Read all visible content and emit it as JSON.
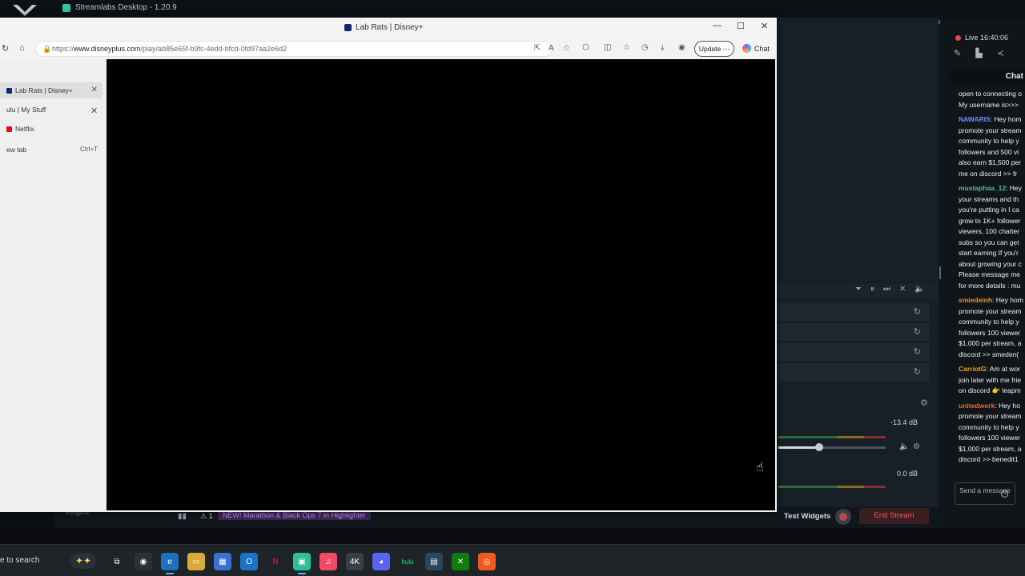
{
  "streamlabs": {
    "window_title": "Streamlabs Desktop - 1.20.9",
    "live_status": "Live 16:40:06",
    "chat_title": "Chat",
    "chat_messages": [
      {
        "user": "",
        "color": "#eef1f3",
        "text": "open to connecting o\nMy username is>>>"
      },
      {
        "user": "NAWARIS",
        "color": "#6f8bff",
        "text": ": Hey hom\npromote your stream\ncommunity to help y\nfollowers and 500 vi\nalso earn $1,500 per\nme on discord >> fr"
      },
      {
        "user": "mustaphaa_12",
        "color": "#4fc08d",
        "text": ": Hey\nyour streams and th\nyou're putting in I ca\ngrow to 1K+ follower\nviewers, 100 chatter\nsubs so you can get\nstart earning If you'r\nabout growing your c\nPlease message me\nfor more details : mu"
      },
      {
        "user": "smiedeinh",
        "color": "#e8913a",
        "text": ": Hey hom\npromote your stream\ncommunity to help y\nfollowers 100 viewer\n$1,000 per stream, a\ndiscord >> smeden("
      },
      {
        "user": "CarriotG",
        "color": "#f0a020",
        "text": ": Am at wor\njoin later with me frie\non discord 👉 leapm"
      },
      {
        "user": "unitedwork",
        "color": "#f06a20",
        "text": ": Hey ho\npromote your stream\ncommunity to help y\nfollowers 100 viewer\n$1,000 per stream, a\ndiscord >> benedit1"
      }
    ],
    "send_placeholder": "Send a message",
    "mixer": {
      "db_top": "-13.4 dB",
      "db_bottom": "0.0 dB",
      "volume_level": 0.38
    },
    "footer": {
      "news": "NEW! Marathon & Black Ops 7 in Highlighter",
      "alert_count": "1",
      "test_widgets": "Test Widgets",
      "end_stream": "End Stream",
      "user": "Kingtoz"
    }
  },
  "edge": {
    "window_title": "Lab Rats | Disney+",
    "url_prefix": "https://",
    "url_host": "www.disneyplus.com",
    "url_path": "/play/ab85e65f-b9fc-4edd-bfcd-0fd97aa2e6d2",
    "update_label": "Update",
    "chat_label": "Chat",
    "tabs": [
      {
        "label": "Lab Rats | Disney+",
        "favicon_color": "#0e2a6e",
        "active": true
      },
      {
        "label": "ulu | My Stuff",
        "favicon_color": "#1ce783",
        "active": false
      },
      {
        "label": "Netflix",
        "favicon_color": "#e50914",
        "active": false
      }
    ],
    "new_tab": {
      "label": "ew tab",
      "shortcut": "Ctrl+T"
    }
  },
  "taskbar": {
    "search_text": "e to search",
    "apps": [
      {
        "icon": "task-view-icon",
        "glyph": "⧉",
        "bg": "transparent"
      },
      {
        "icon": "chrome-icon",
        "glyph": "◉",
        "bg": "#2b3137"
      },
      {
        "icon": "edge-icon",
        "glyph": "e",
        "bg": "#1f6fbf",
        "active": true
      },
      {
        "icon": "file-explorer-icon",
        "glyph": "▭",
        "bg": "#d9a93a"
      },
      {
        "icon": "store-icon",
        "glyph": "▦",
        "bg": "#3b6fd0"
      },
      {
        "icon": "outlook-icon",
        "glyph": "O",
        "bg": "#1a73c8"
      },
      {
        "icon": "netflix-icon",
        "glyph": "N",
        "bg": "transparent"
      },
      {
        "icon": "streamlabs-icon",
        "glyph": "▣",
        "bg": "#2fbf96",
        "active": true
      },
      {
        "icon": "music-icon",
        "glyph": "♫",
        "bg": "#f24a65"
      },
      {
        "icon": "4k-downloader-icon",
        "glyph": "4K",
        "bg": "#3a3f44"
      },
      {
        "icon": "discord-icon",
        "glyph": "◕",
        "bg": "#5865f2"
      },
      {
        "icon": "hulu-icon",
        "glyph": "hulu",
        "bg": "transparent"
      },
      {
        "icon": "steam-icon",
        "glyph": "▤",
        "bg": "#2a475e"
      },
      {
        "icon": "xbox-icon",
        "glyph": "✕",
        "bg": "#107c10"
      },
      {
        "icon": "origin-icon",
        "glyph": "◎",
        "bg": "#f05a1a"
      }
    ]
  }
}
